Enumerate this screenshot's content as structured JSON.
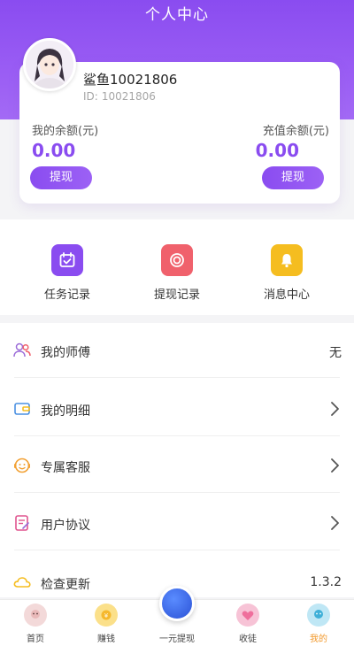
{
  "header": {
    "title": "个人中心"
  },
  "profile": {
    "name": "鲨鱼10021806",
    "id_label": "ID:",
    "id_value": "10021806",
    "balance_label": "我的余额(元)",
    "balance_value": "0.00",
    "recharge_label": "充值余额(元)",
    "recharge_value": "0.00",
    "withdraw_button": "提现",
    "recharge_withdraw_button": "提现"
  },
  "quick_menu": {
    "items": [
      {
        "label": "任务记录",
        "icon": "calendar-icon",
        "color": "#8a4cf0"
      },
      {
        "label": "提现记录",
        "icon": "record-icon",
        "color": "#f0616c"
      },
      {
        "label": "消息中心",
        "icon": "bell-icon",
        "color": "#f5bd20"
      }
    ]
  },
  "list": {
    "items": [
      {
        "label": "我的师傅",
        "right": "无",
        "icon": "users-icon"
      },
      {
        "label": "我的明细",
        "right": "",
        "icon": "wallet-icon"
      },
      {
        "label": "专属客服",
        "right": "",
        "icon": "service-icon"
      },
      {
        "label": "用户协议",
        "right": "",
        "icon": "document-icon"
      },
      {
        "label": "检查更新",
        "right": "1.3.2",
        "icon": "cloud-icon"
      }
    ]
  },
  "bottom_nav": {
    "items": [
      {
        "label": "首页",
        "icon": "home-icon"
      },
      {
        "label": "赚钱",
        "icon": "earn-icon"
      },
      {
        "label": "一元提现",
        "icon": "cash-icon"
      },
      {
        "label": "收徒",
        "icon": "apprentice-icon"
      },
      {
        "label": "我的",
        "icon": "profile-icon"
      }
    ],
    "active_index": 4
  },
  "colors": {
    "brand": "#8a4cf0",
    "active_nav": "#f29a2e"
  }
}
